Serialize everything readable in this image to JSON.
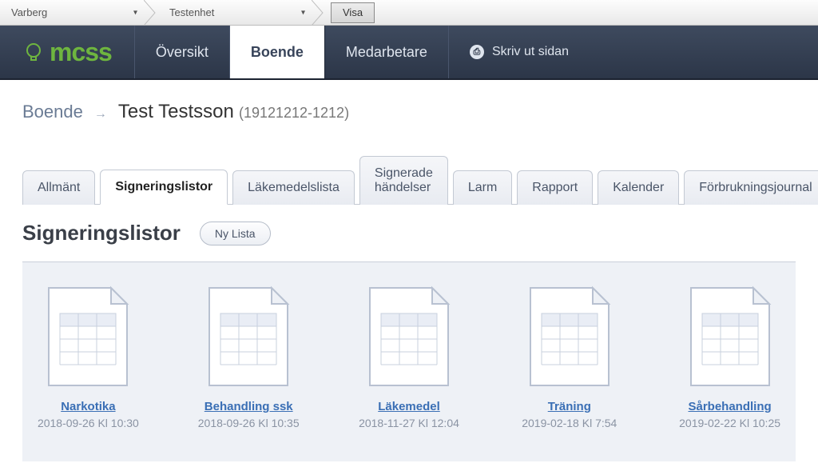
{
  "topbar": {
    "crumbs": [
      "Varberg",
      "Testenhet"
    ],
    "show_button": "Visa"
  },
  "logo_text": "mcss",
  "nav": {
    "items": [
      "Översikt",
      "Boende",
      "Medarbetare"
    ],
    "active_index": 1,
    "print": "Skriv ut sidan"
  },
  "breadcrumb": {
    "root": "Boende",
    "name": "Test Testsson",
    "id": "(19121212-1212)"
  },
  "tabs": {
    "items": [
      "Allmänt",
      "Signeringslistor",
      "Läkemedelslista",
      "Signerade händelser",
      "Larm",
      "Rapport",
      "Kalender",
      "Förbrukningsjournal"
    ],
    "active_index": 1
  },
  "section": {
    "title": "Signeringslistor",
    "new_button": "Ny Lista"
  },
  "cards": [
    {
      "title": "Narkotika",
      "date": "2018-09-26 Kl 10:30"
    },
    {
      "title": "Behandling ssk",
      "date": "2018-09-26 Kl 10:35"
    },
    {
      "title": "Läkemedel",
      "date": "2018-11-27 Kl 12:04"
    },
    {
      "title": "Träning",
      "date": "2019-02-18 Kl 7:54"
    },
    {
      "title": "Sårbehandling",
      "date": "2019-02-22 Kl 10:25"
    }
  ]
}
